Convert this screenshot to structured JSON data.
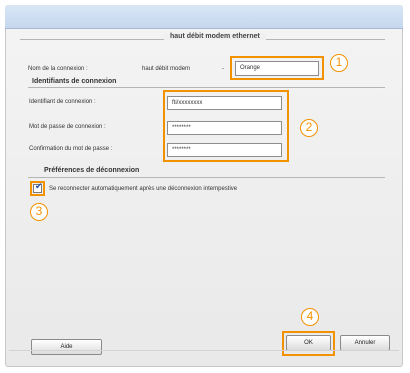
{
  "dialog": {
    "connection_group_title": "haut débit modem ethernet",
    "connection_name_label": "Nom de la connexion :",
    "connection_type_text": "haut débit modem",
    "connection_name_value": "Orange"
  },
  "identifiers": {
    "section_title": "Identifiants de connexion",
    "login_label": "Identifiant de connexion :",
    "login_value": "fti/xxxxxxxx",
    "password_label": "Mot de passe de connexion :",
    "password_value": "********",
    "password_confirm_label": "Confirmation du mot de passe :",
    "password_confirm_value": "********"
  },
  "disconnection": {
    "section_title": "Préférences de déconnexion",
    "reconnect_label": "Se reconnecter automatiquement après une déconnexion intempestive",
    "reconnect_checked": true
  },
  "buttons": {
    "help": "Aide",
    "ok": "OK",
    "cancel": "Annuler"
  },
  "callouts": [
    "1",
    "2",
    "3",
    "4"
  ],
  "colors": {
    "callout": "#f39200",
    "title_bar": "#c5d7ee"
  }
}
